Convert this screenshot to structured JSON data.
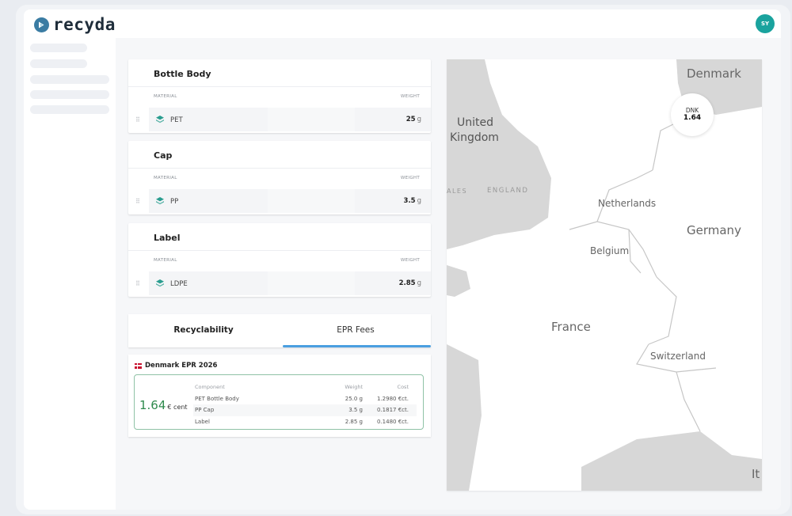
{
  "app": {
    "logo_text": "recyda",
    "avatar_initials": "SY"
  },
  "colors": {
    "accent": "#4a9fe0",
    "brand": "#3a7ca3",
    "avatar": "#1aa39e",
    "epr_green": "#2f8a4d",
    "material_icon": "#2a9d8f"
  },
  "components": [
    {
      "title": "Bottle Body",
      "material_header": "MATERIAL",
      "weight_header": "WEIGHT",
      "material": "PET",
      "weight": "25",
      "unit": "g",
      "icon": "layers-icon"
    },
    {
      "title": "Cap",
      "material_header": "MATERIAL",
      "weight_header": "WEIGHT",
      "material": "PP",
      "weight": "3.5",
      "unit": "g",
      "icon": "layers-icon"
    },
    {
      "title": "Label",
      "material_header": "MATERIAL",
      "weight_header": "WEIGHT",
      "material": "LDPE",
      "weight": "2.85",
      "unit": "g",
      "icon": "layers-icon"
    }
  ],
  "tabs": [
    {
      "label": "Recyclability",
      "active": false
    },
    {
      "label": "EPR Fees",
      "active": true
    }
  ],
  "epr": {
    "title": "Denmark EPR 2026",
    "total_value": "1.64",
    "total_unit": "€ cent",
    "headers": {
      "component": "Component",
      "weight": "Weight",
      "cost": "Cost"
    },
    "rows": [
      {
        "component": "PET Bottle Body",
        "weight": "25.0 g",
        "cost": "1.2980 €ct."
      },
      {
        "component": "PP Cap",
        "weight": "3.5 g",
        "cost": "0.1817 €ct."
      },
      {
        "component": "Label",
        "weight": "2.85 g",
        "cost": "0.1480 €ct."
      }
    ]
  },
  "map": {
    "labels": {
      "denmark": "Denmark",
      "united_kingdom_1": "United",
      "united_kingdom_2": "Kingdom",
      "wales": "ALES",
      "england": "ENGLAND",
      "netherlands": "Netherlands",
      "germany": "Germany",
      "belgium": "Belgium",
      "france": "France",
      "switzerland": "Switzerland",
      "italy": "It"
    },
    "bubble": {
      "code": "DNK",
      "value": "1.64"
    }
  }
}
